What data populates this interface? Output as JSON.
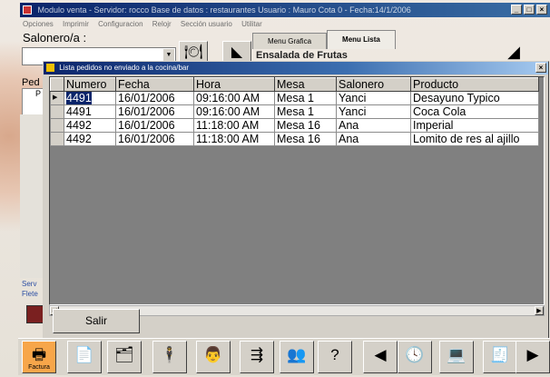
{
  "main_window": {
    "title": "Modulo venta - Servidor: rocco Base de datos : restaurantes Usuario : Mauro Cota 0 - Fecha:14/1/2006",
    "menu": [
      "Opciones",
      "Imprimir",
      "Configuracion",
      "Relojr",
      "Sección usuario",
      "Utilitar"
    ],
    "salonero_label": "Salonero/a :",
    "tabs": [
      "Menu Grafica",
      "Menu Lista"
    ],
    "panel_text": "Ensalada de Frutas",
    "ped_label": "Ped",
    "ped_cell": "P",
    "serv_label": "Serv",
    "flete_label": "Flete"
  },
  "dialog": {
    "title": "Lista pedidos no enviado a la cocina/bar",
    "columns": [
      "Numero",
      "Fecha",
      "Hora",
      "Mesa",
      "Salonero",
      "Producto"
    ],
    "rows": [
      {
        "numero": "4491",
        "fecha": "16/01/2006",
        "hora": "09:16:00 AM",
        "mesa": "Mesa 1",
        "salonero": "Yanci",
        "producto": "Desayuno Typico"
      },
      {
        "numero": "4491",
        "fecha": "16/01/2006",
        "hora": "09:16:00 AM",
        "mesa": "Mesa 1",
        "salonero": "Yanci",
        "producto": "Coca Cola"
      },
      {
        "numero": "4492",
        "fecha": "16/01/2006",
        "hora": "11:18:00 AM",
        "mesa": "Mesa 16",
        "salonero": "Ana",
        "producto": "Imperial"
      },
      {
        "numero": "4492",
        "fecha": "16/01/2006",
        "hora": "11:18:00 AM",
        "mesa": "Mesa 16",
        "salonero": "Ana",
        "producto": "Lomito de res al ajillo"
      }
    ],
    "salir_label": "Salir"
  },
  "toolbar": {
    "factura_label": "Factura",
    "icons": [
      "printer-icon",
      "document-icon",
      "tray-icon",
      "waiter-icon",
      "cook-icon",
      "split-icon",
      "diners-icon",
      "question-icon",
      "arrow-left-icon",
      "clock-icon",
      "cashier-icon",
      "register-icon",
      "arrow-right-icon"
    ]
  },
  "colors": {
    "titlebar": "#0a246a",
    "face": "#d4d0c8",
    "selection": "#0a246a",
    "factura": "#f7a64a"
  }
}
